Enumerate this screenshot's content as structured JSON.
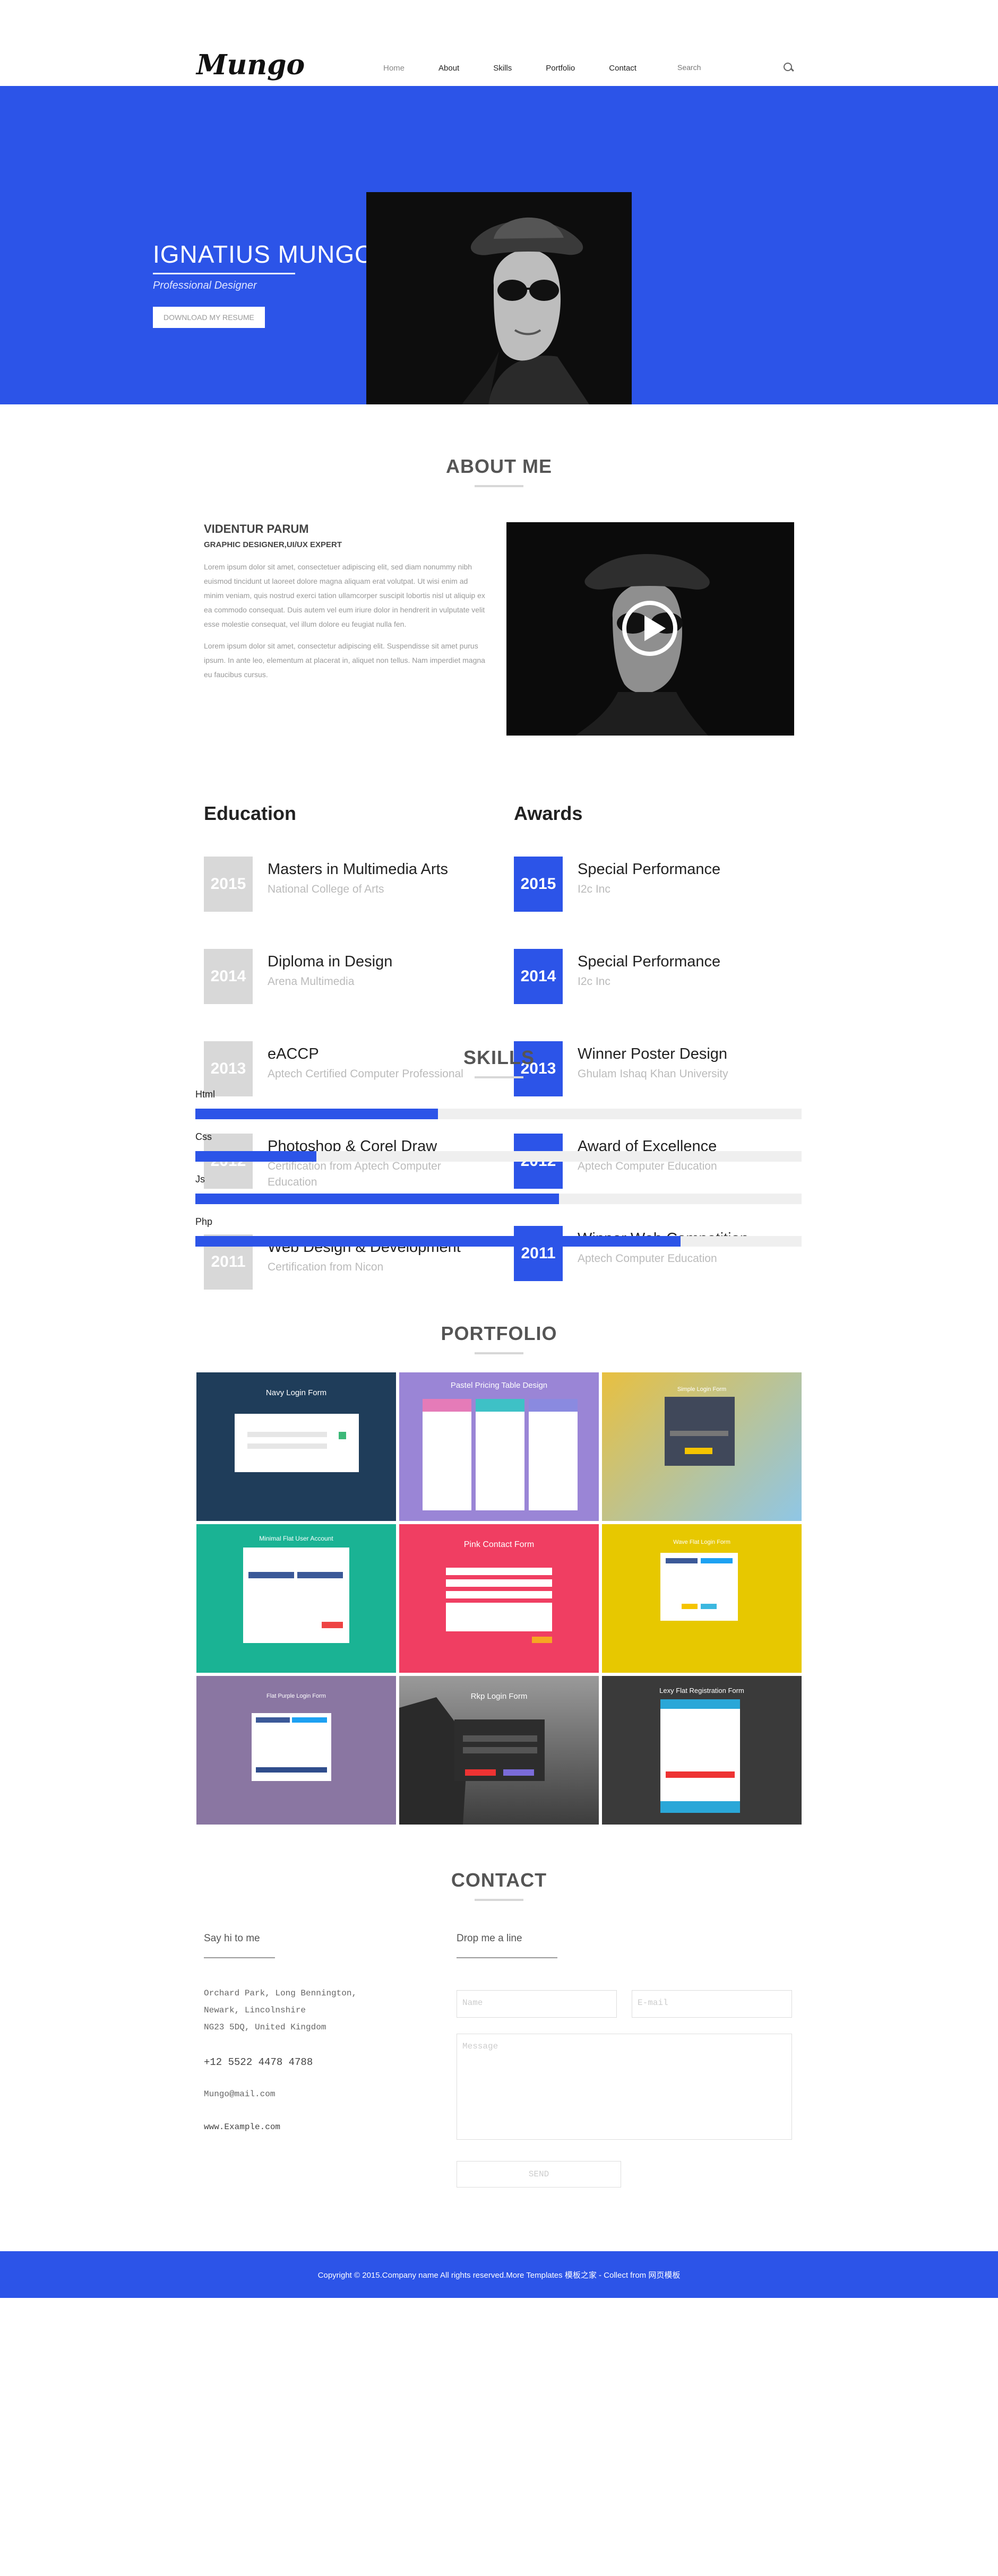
{
  "header": {
    "logo": "Mungo",
    "nav": [
      "Home",
      "About",
      "Skills",
      "Portfolio",
      "Contact"
    ],
    "search_placeholder": "Search"
  },
  "hero": {
    "name": "IGNATIUS MUNGO",
    "role": "Professional Designer",
    "button": "DOWNLOAD MY RESUME"
  },
  "about": {
    "title": "ABOUT ME",
    "name": "VIDENTUR PARUM",
    "subtitle": "GRAPHIC DESIGNER,UI/UX EXPERT",
    "paragraph1": "Lorem ipsum dolor sit amet, consectetuer adipiscing elit, sed diam nonummy nibh euismod tincidunt ut laoreet dolore magna aliquam erat volutpat. Ut wisi enim ad minim veniam, quis nostrud exerci tation ullamcorper suscipit lobortis nisl ut aliquip ex ea commodo consequat. Duis autem vel eum iriure dolor in hendrerit in vulputate velit esse molestie consequat, vel illum dolore eu feugiat nulla fen.",
    "paragraph2": "Lorem ipsum dolor sit amet, consectetur adipiscing elit. Suspendisse sit amet purus ipsum. In ante leo, elementum at placerat in, aliquet non tellus. Nam imperdiet magna eu faucibus cursus."
  },
  "education": {
    "title": "Education",
    "items": [
      {
        "year": "2015",
        "title": "Masters in Multimedia Arts",
        "place": "National College of Arts"
      },
      {
        "year": "2014",
        "title": "Diploma in Design",
        "place": "Arena Multimedia"
      },
      {
        "year": "2013",
        "title": "eACCP",
        "place": "Aptech Certified Computer Professional"
      },
      {
        "year": "2012",
        "title": "Photoshop & Corel Draw",
        "place": "Certification from Aptech Computer Education"
      },
      {
        "year": "2011",
        "title": "Web Design & Development",
        "place": "Certification from Nicon"
      }
    ]
  },
  "awards": {
    "title": "Awards",
    "items": [
      {
        "year": "2015",
        "title": "Special Performance",
        "place": "I2c Inc"
      },
      {
        "year": "2014",
        "title": "Special Performance",
        "place": "I2c Inc"
      },
      {
        "year": "2013",
        "title": "Winner Poster Design",
        "place": "Ghulam Ishaq Khan University"
      },
      {
        "year": "2012",
        "title": "Award of Excellence",
        "place": "Aptech Computer Education"
      },
      {
        "year": "2011",
        "title": "Winner Web Competition",
        "place": "Aptech Computer Education"
      }
    ]
  },
  "skills": {
    "title": "SKILLS",
    "items": [
      {
        "label": "Html",
        "level": 0.4
      },
      {
        "label": "Css",
        "level": 0.2
      },
      {
        "label": "Js",
        "level": 0.6
      },
      {
        "label": "Php",
        "level": 0.8
      }
    ]
  },
  "portfolio": {
    "title": "PORTFOLIO",
    "tiles": [
      {
        "label": "Navy Login Form",
        "color": "#1f3d5a"
      },
      {
        "label": "Pastel Pricing Table Design",
        "color": "#9a85d6"
      },
      {
        "label": "Simple Login Form",
        "color": "#9cc4d8"
      },
      {
        "label": "Minimal Flat User Account",
        "color": "#1ab394"
      },
      {
        "label": "Pink Contact Form",
        "color": "#f03e62"
      },
      {
        "label": "Wave Flat Login Form",
        "color": "#e7c800"
      },
      {
        "label": "Flat Purple Login Form",
        "color": "#8a76a2"
      },
      {
        "label": "Rkp Login Form",
        "color": "#5f5f5f"
      },
      {
        "label": "Lexy Flat Registration Form",
        "color": "#3a3a3a"
      }
    ]
  },
  "contact": {
    "title": "CONTACT",
    "left_heading": "Say hi to me",
    "address": [
      "Orchard Park, Long Bennington,",
      "Newark, Lincolnshire",
      "NG23 5DQ, United Kingdom"
    ],
    "phone": "+12 5522 4478 4788",
    "email": "Mungo@mail.com",
    "website": "www.Example.com",
    "right_heading": "Drop me a line",
    "name_placeholder": "Name",
    "email_placeholder": "E-mail",
    "message_placeholder": "Message",
    "send": "SEND"
  },
  "footer": {
    "text": "Copyright © 2015.Company name All rights reserved.More Templates 模板之家 - Collect from 网页模板"
  },
  "colors": {
    "accent": "#2c54e8",
    "year_gray": "#d8d8d8"
  }
}
